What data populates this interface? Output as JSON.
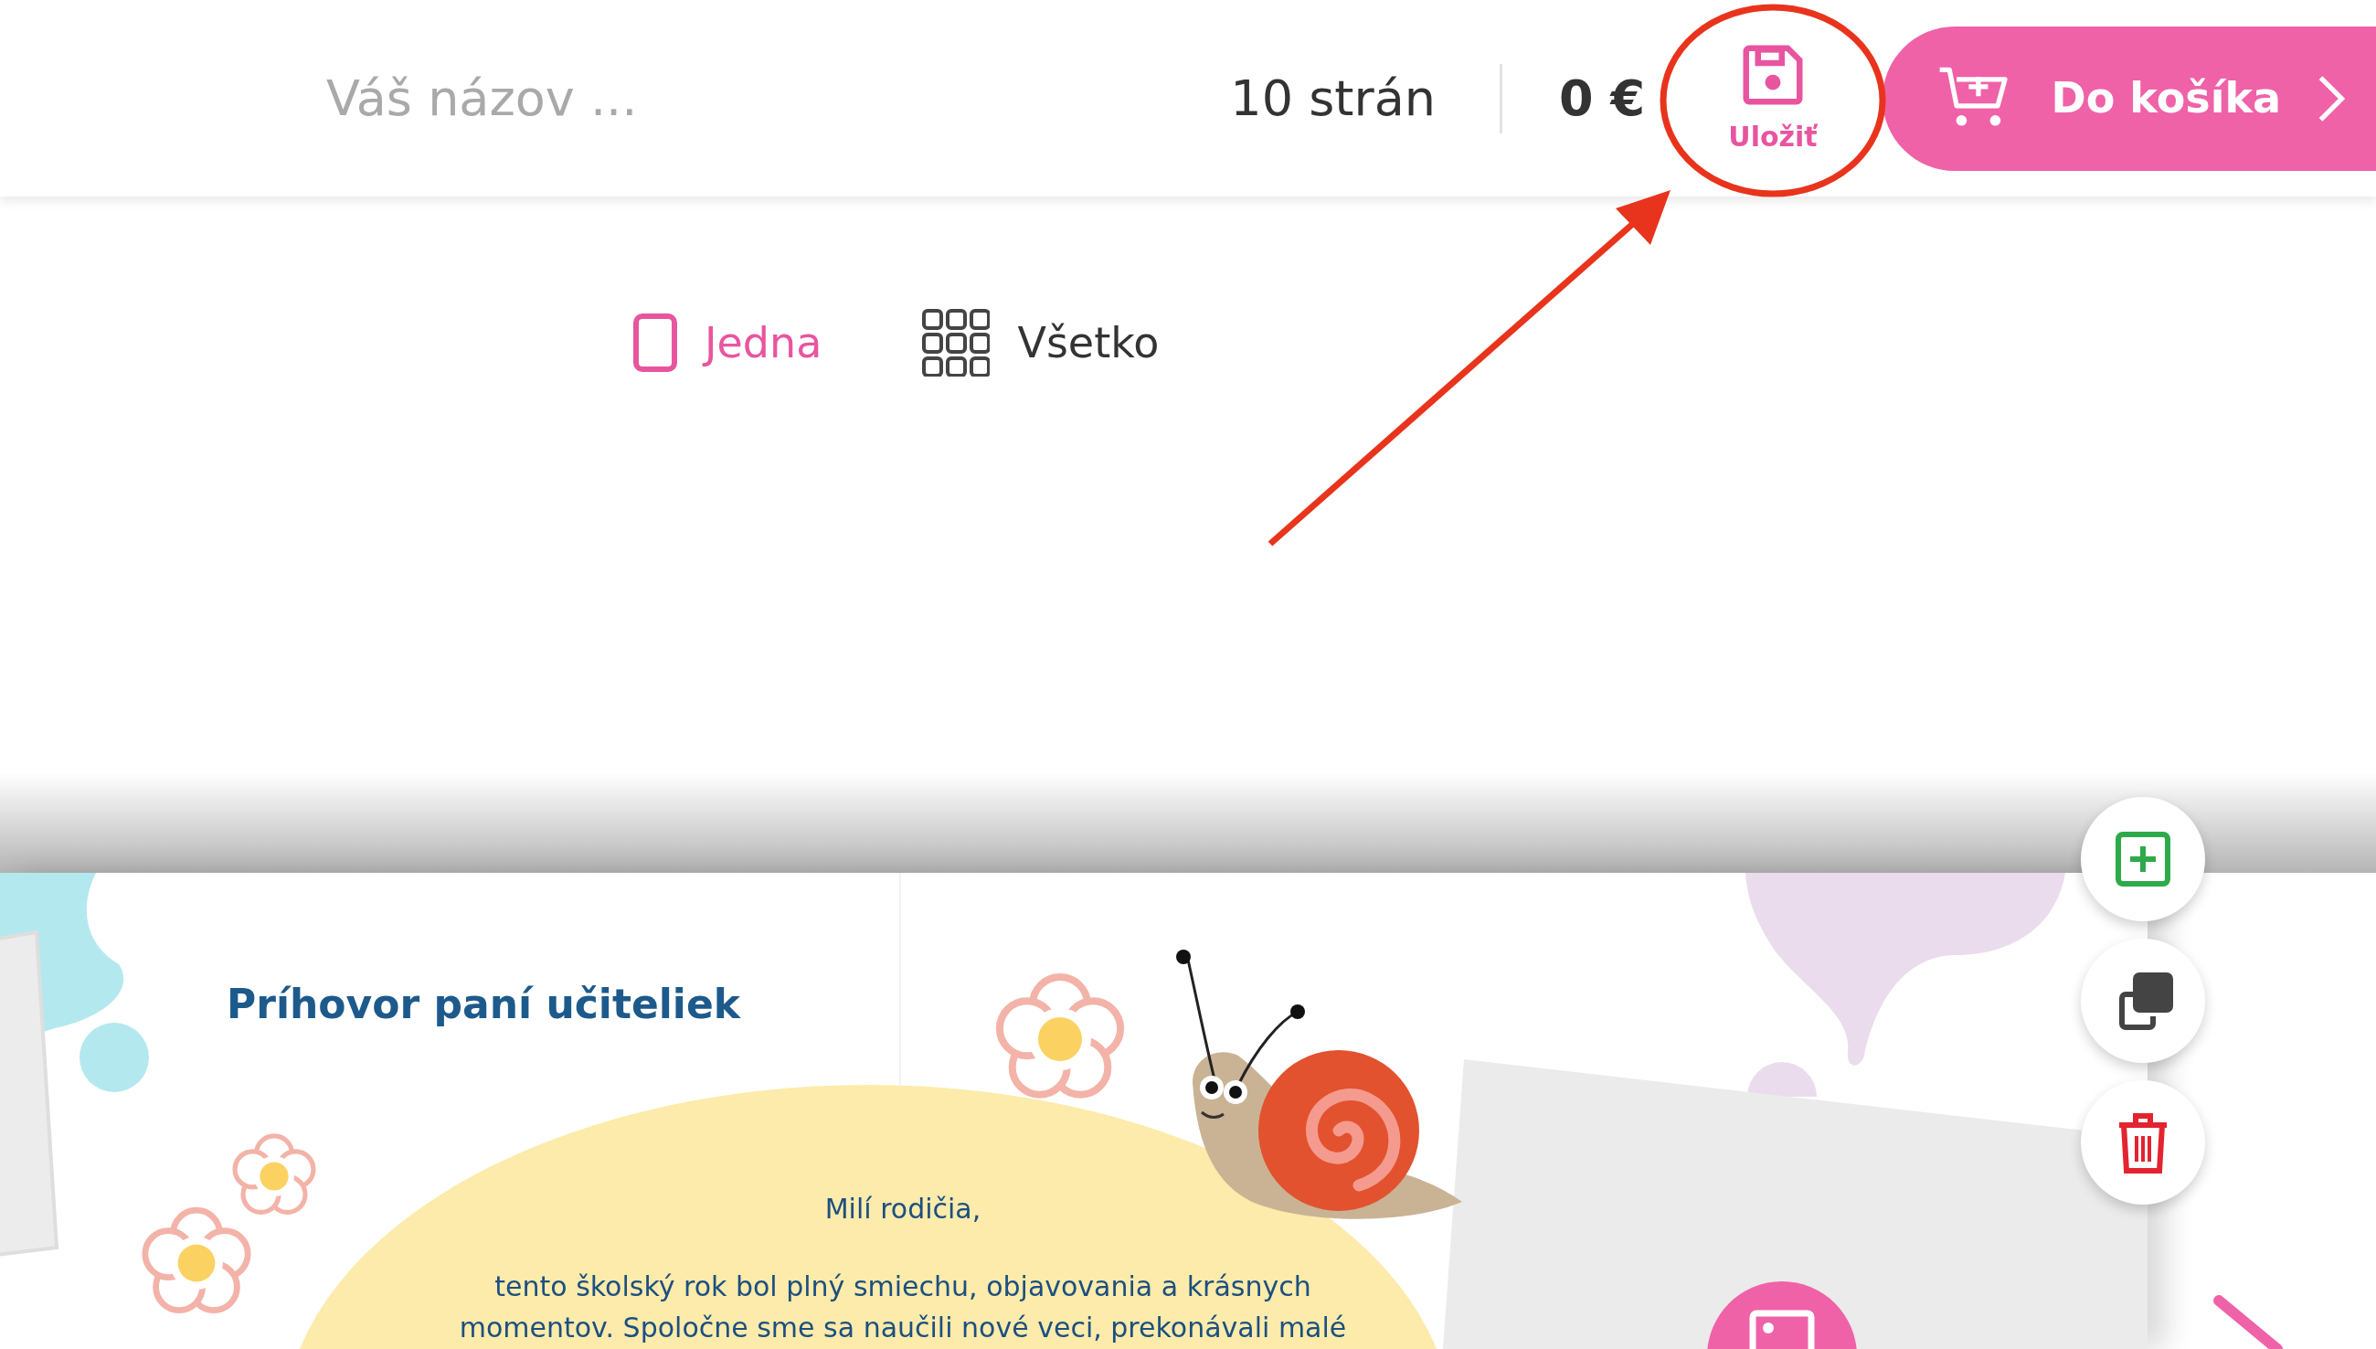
{
  "header": {
    "title_placeholder": "Váš názov ...",
    "pages": "10 strán",
    "price": "0 €",
    "save_label": "Uložiť",
    "cart_label": "Do košíka"
  },
  "view_tabs": [
    {
      "label": "Jedna",
      "kind": "single",
      "selected": true
    },
    {
      "label": "Všetko",
      "kind": "all",
      "selected": false
    }
  ],
  "page": {
    "title": "Príhovor paní učiteliek",
    "greeting": "Milí rodičia,",
    "body": "tento školský rok bol plný smiechu, objavovania a krásnych\nmomentov. Spoločne sme sa naučili nové veci, prekonávali malé"
  },
  "page_tools": [
    {
      "kind": "add"
    },
    {
      "kind": "duplicate"
    },
    {
      "kind": "delete"
    }
  ]
}
